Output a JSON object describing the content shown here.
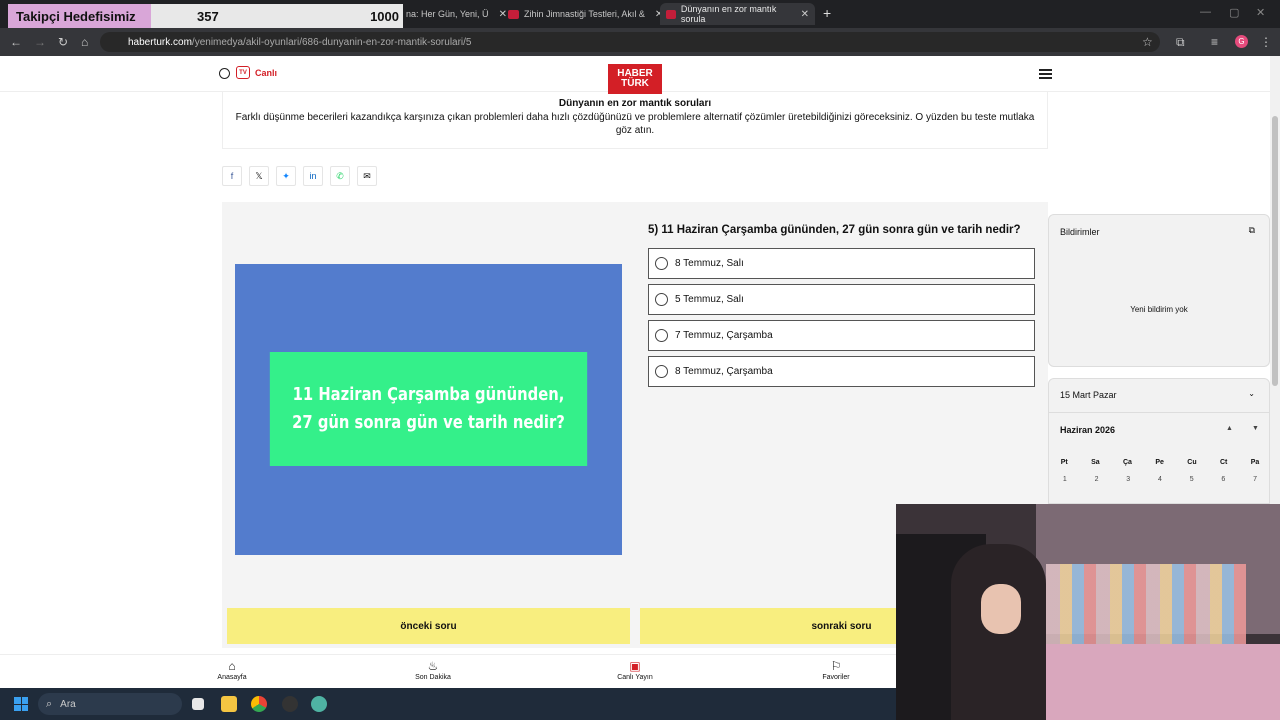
{
  "overlay": {
    "label": "Takipçi Hedefisimiz",
    "current": "357",
    "goal": "1000"
  },
  "tabs": [
    {
      "title": "na: Her Gün, Yeni, Ü"
    },
    {
      "title": "Zihin Jimnastiği Testleri, Akıl &"
    },
    {
      "title": "Dünyanın en zor mantık sorula"
    }
  ],
  "browser": {
    "url_host": "haberturk.com",
    "url_path": "/yenimedya/akil-oyunlari/686-dunyanin-en-zor-mantik-sorulari/5",
    "profile_initial": "G"
  },
  "header": {
    "live_label": "Canlı",
    "logo_top": "HABER",
    "logo_bottom": "TÜRK",
    "tv_badge": "TV"
  },
  "intro": {
    "title": "Dünyanın en zor mantık soruları",
    "text": "Farklı düşünme becerileri kazandıkça karşınıza çıkan problemleri daha hızlı çözdüğünüzü ve problemlere alternatif çözümler üretebildiğinizi göreceksiniz. O yüzden bu teste mutlaka göz atın."
  },
  "share": [
    "f",
    "𝕏",
    "✦",
    "in",
    "✆",
    "✉"
  ],
  "quiz": {
    "question": "5) 11 Haziran Çarşamba gününden, 27 gün sonra gün ve tarih nedir?",
    "image_line1": "11 Haziran Çarşamba gününden,",
    "image_line2": "27 gün sonra gün ve tarih nedir?",
    "options": [
      "8 Temmuz, Salı",
      "5 Temmuz, Salı",
      "7 Temmuz, Çarşamba",
      "8 Temmuz, Çarşamba"
    ],
    "prev": "önceki soru",
    "next": "sonraki soru"
  },
  "bottom_nav": [
    "Anasayfa",
    "Son Dakika",
    "Canlı Yayın",
    "Favoriler"
  ],
  "notifications": {
    "title": "Bildirimler",
    "empty": "Yeni bildirim yok"
  },
  "calendar": {
    "date": "15 Mart Pazar",
    "month": "Haziran 2026",
    "days": [
      "Pt",
      "Sa",
      "Ça",
      "Pe",
      "Cu",
      "Ct",
      "Pa"
    ],
    "nums": [
      "1",
      "2",
      "3",
      "4",
      "5",
      "6",
      "7"
    ]
  },
  "taskbar": {
    "search": "Ara"
  },
  "colors": {
    "brand_red": "#d31f26",
    "button_yellow": "#f8ee7f",
    "image_blue": "#537ccd",
    "image_green": "#34f08a"
  }
}
